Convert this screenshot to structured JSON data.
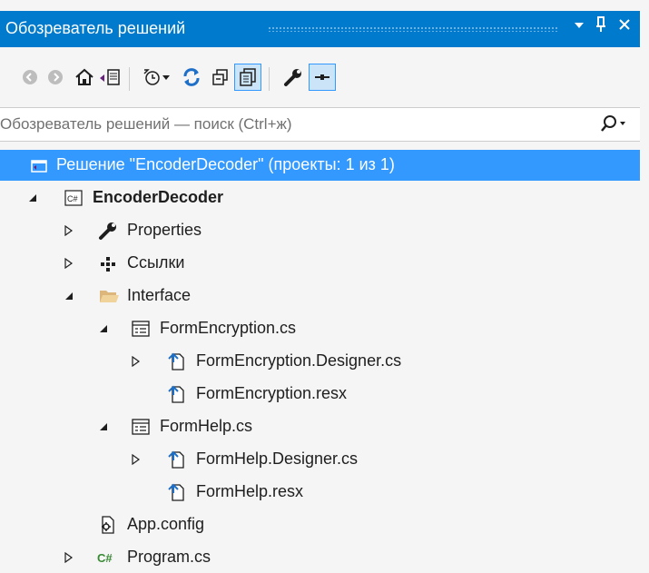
{
  "window": {
    "title": "Обозреватель решений"
  },
  "titlebar_buttons": [
    "pin-dropdown-icon",
    "pin-icon",
    "close-icon"
  ],
  "toolbar": {
    "buttons": [
      "back-icon",
      "forward-icon",
      "home-icon",
      "switch-views-icon",
      "pending-changes-icon",
      "dropdown-icon",
      "sync-icon",
      "collapse-all-icon",
      "show-all-files-icon",
      "properties-icon",
      "preview-icon"
    ]
  },
  "search": {
    "placeholder": "Обозреватель решений — поиск (Ctrl+ж)"
  },
  "tree": {
    "solution": "Решение \"EncoderDecoder\" (проекты: 1 из 1)",
    "project": "EncoderDecoder",
    "properties": "Properties",
    "references": "Ссылки",
    "folder": "Interface",
    "form_encryption": "FormEncryption.cs",
    "form_encryption_designer": "FormEncryption.Designer.cs",
    "form_encryption_resx": "FormEncryption.resx",
    "form_help": "FormHelp.cs",
    "form_help_designer": "FormHelp.Designer.cs",
    "form_help_resx": "FormHelp.resx",
    "app_config": "App.config",
    "program": "Program.cs"
  },
  "colors": {
    "accent": "#007acc",
    "selection": "#3399ff",
    "csharp": "#388a34"
  }
}
